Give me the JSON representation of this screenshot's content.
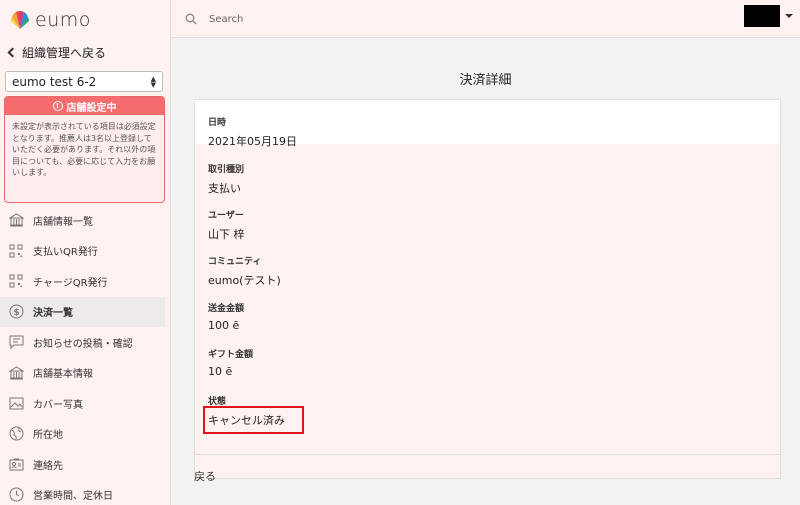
{
  "brand": {
    "name": "eumo"
  },
  "sidebar": {
    "back_label": "組織管理へ戻る",
    "store_selected": "eumo test 6-2",
    "alert": {
      "title": "店舗設定中",
      "body": "未設定が表示されている項目は必須設定となります。推薦人は3名以上登録していただく必要があります。それ以外の項目についても、必要に応じて入力をお願いします。"
    },
    "items": [
      {
        "label": "店舗情報一覧",
        "icon": "building-icon"
      },
      {
        "label": "支払いQR発行",
        "icon": "qr-code-icon"
      },
      {
        "label": "チャージQR発行",
        "icon": "qr-code-icon"
      },
      {
        "label": "決済一覧",
        "icon": "dollar-icon",
        "active": true
      },
      {
        "label": "お知らせの投稿・確認",
        "icon": "message-icon"
      },
      {
        "label": "店舗基本情報",
        "icon": "building-icon"
      },
      {
        "label": "カバー写真",
        "icon": "image-icon"
      },
      {
        "label": "所在地",
        "icon": "globe-icon"
      },
      {
        "label": "連絡先",
        "icon": "contact-card-icon"
      },
      {
        "label": "営業時間、定休日",
        "icon": "clock-icon"
      }
    ]
  },
  "topbar": {
    "search_placeholder": "Search"
  },
  "main": {
    "title": "決済詳細",
    "fields": [
      {
        "label": "日時",
        "value": "2021年05月19日"
      },
      {
        "label": "取引種別",
        "value": "支払い"
      },
      {
        "label": "ユーザー",
        "value": "山下 梓"
      },
      {
        "label": "コミュニティ",
        "value": "eumo(テスト)"
      },
      {
        "label": "送金金額",
        "value": "100 ē"
      },
      {
        "label": "ギフト金額",
        "value": "10 ē"
      },
      {
        "label": "状態",
        "value": "キャンセル済み"
      }
    ],
    "back_label": "戻る"
  },
  "colors": {
    "accent_red": "#f56c6e",
    "highlight_red": "#e0141a",
    "panel_pink": "#fdf2f0"
  }
}
